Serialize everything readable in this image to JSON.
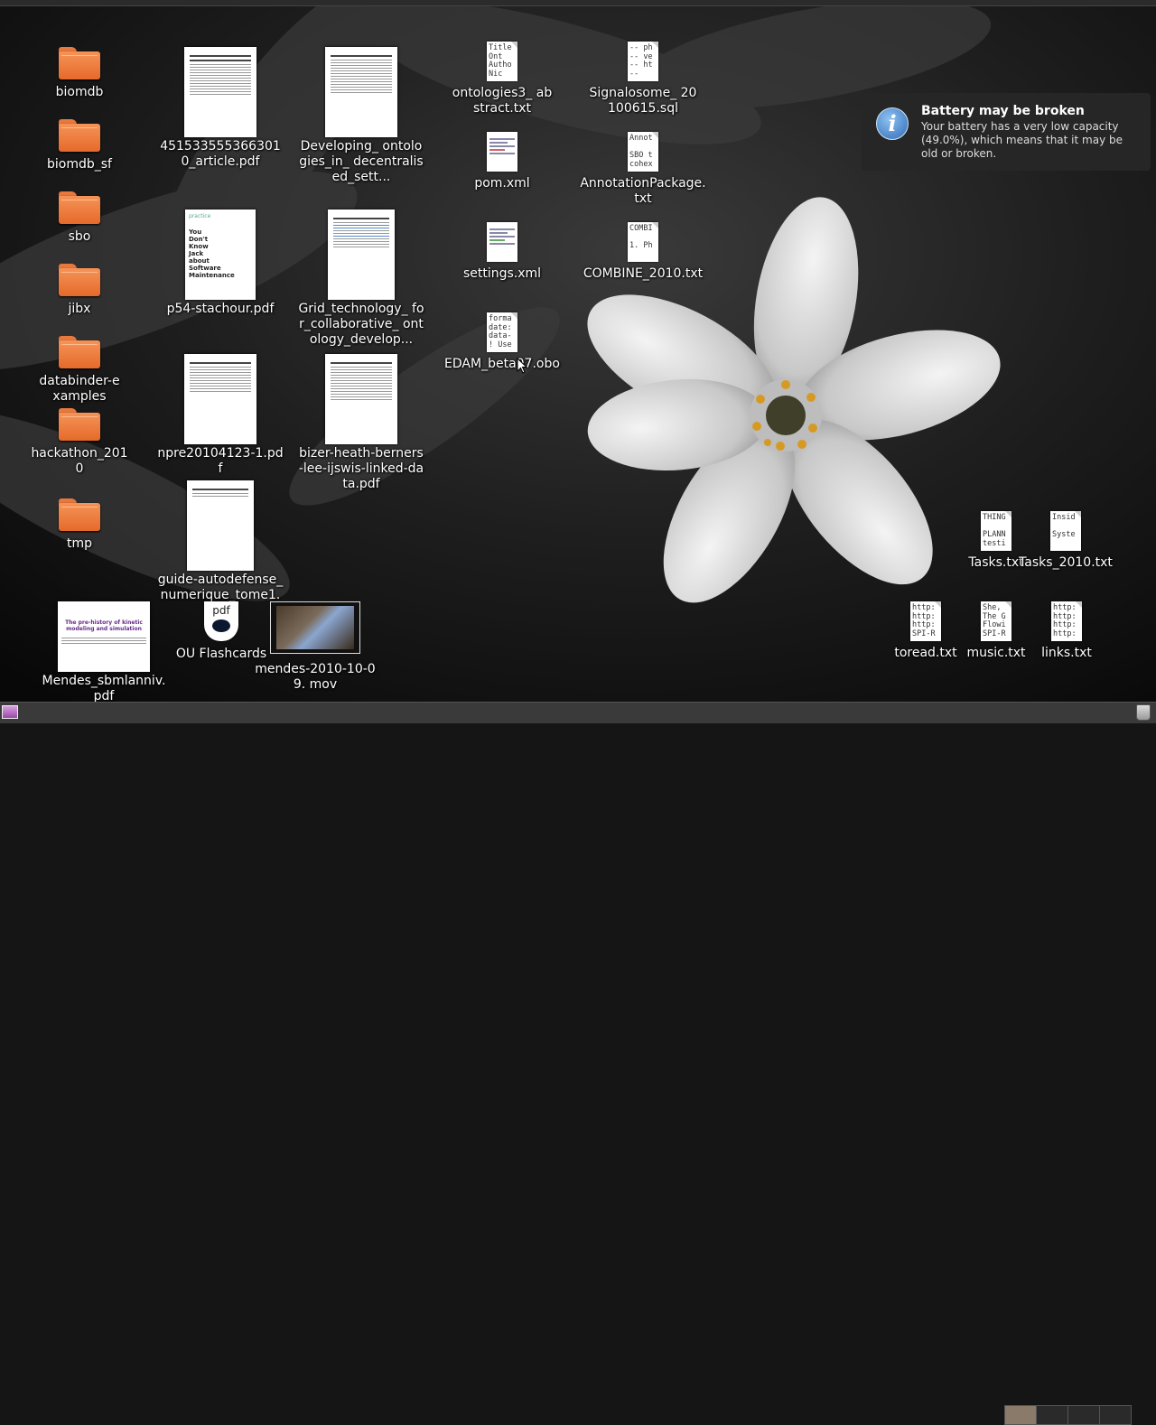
{
  "notification": {
    "title": "Battery may be broken",
    "body": "Your battery has a very low capacity (49.0%), which means that it may be old or broken.",
    "icon": "info-icon"
  },
  "desktop": {
    "folders": [
      "biomdb",
      "biomdb_sf",
      "sbo",
      "jibx",
      "databinder-examples",
      "hackathon_2010",
      "tmp"
    ],
    "pdfs": {
      "p1": "4515335553663010_article.pdf",
      "p2": "Developing_ ontologies_in_ decentralised_sett...",
      "p3": "p54-stachour.pdf",
      "p4": "Grid_technology_ for_collaborative_ ontology_develop...",
      "p5": "npre20104123-1.pdf",
      "p6": "bizer-heath-berners-lee-ijswis-linked-data.pdf",
      "p7": "guide-autodefense_ numerique_tome1.",
      "p8": "Mendes_sbmlanniv. pdf",
      "p3_cover": "You Don't Know Jack about Software Maintenance",
      "p3_header": "practice",
      "p8_cover": "The pre-history of kinetic modeling and simulation"
    },
    "textfiles": {
      "t1": {
        "label": "ontologies3_ abstract.txt",
        "preview": "Title\nOnt\nAutho\nNic"
      },
      "t2": {
        "label": "Signalosome_ 20100615.sql",
        "preview": "-- ph\n-- ve\n-- ht\n--"
      },
      "t3": {
        "label": "pom.xml",
        "preview": ""
      },
      "t4": {
        "label": "AnnotationPackage. txt",
        "preview": "Annot\n\nSBO t\ncohex"
      },
      "t5": {
        "label": "settings.xml",
        "preview": ""
      },
      "t6": {
        "label": "COMBINE_2010.txt",
        "preview": "COMBI\n\n1. Ph"
      },
      "t7": {
        "label": "EDAM_beta07.obo",
        "preview": "forma\ndate:\ndata-\n! Use"
      },
      "t8": {
        "label": "Tasks.txt",
        "preview": "THING\n\nPLANN\ntesti"
      },
      "t9": {
        "label": "Tasks_2010.txt",
        "preview": "Insid\n\nSyste"
      },
      "t10": {
        "label": "toread.txt",
        "preview": "http:\nhttp:\nhttp:\nSPI-R"
      },
      "t11": {
        "label": "music.txt",
        "preview": "She,\nThe G\nFlowi\nSPI-R"
      },
      "t12": {
        "label": "links.txt",
        "preview": "http:\nhttp:\nhttp:\nhttp:"
      }
    },
    "flashcards": {
      "label": "OU Flashcards",
      "badge": "pdf"
    },
    "movie": {
      "label": "mendes-2010-10-09. mov"
    }
  }
}
